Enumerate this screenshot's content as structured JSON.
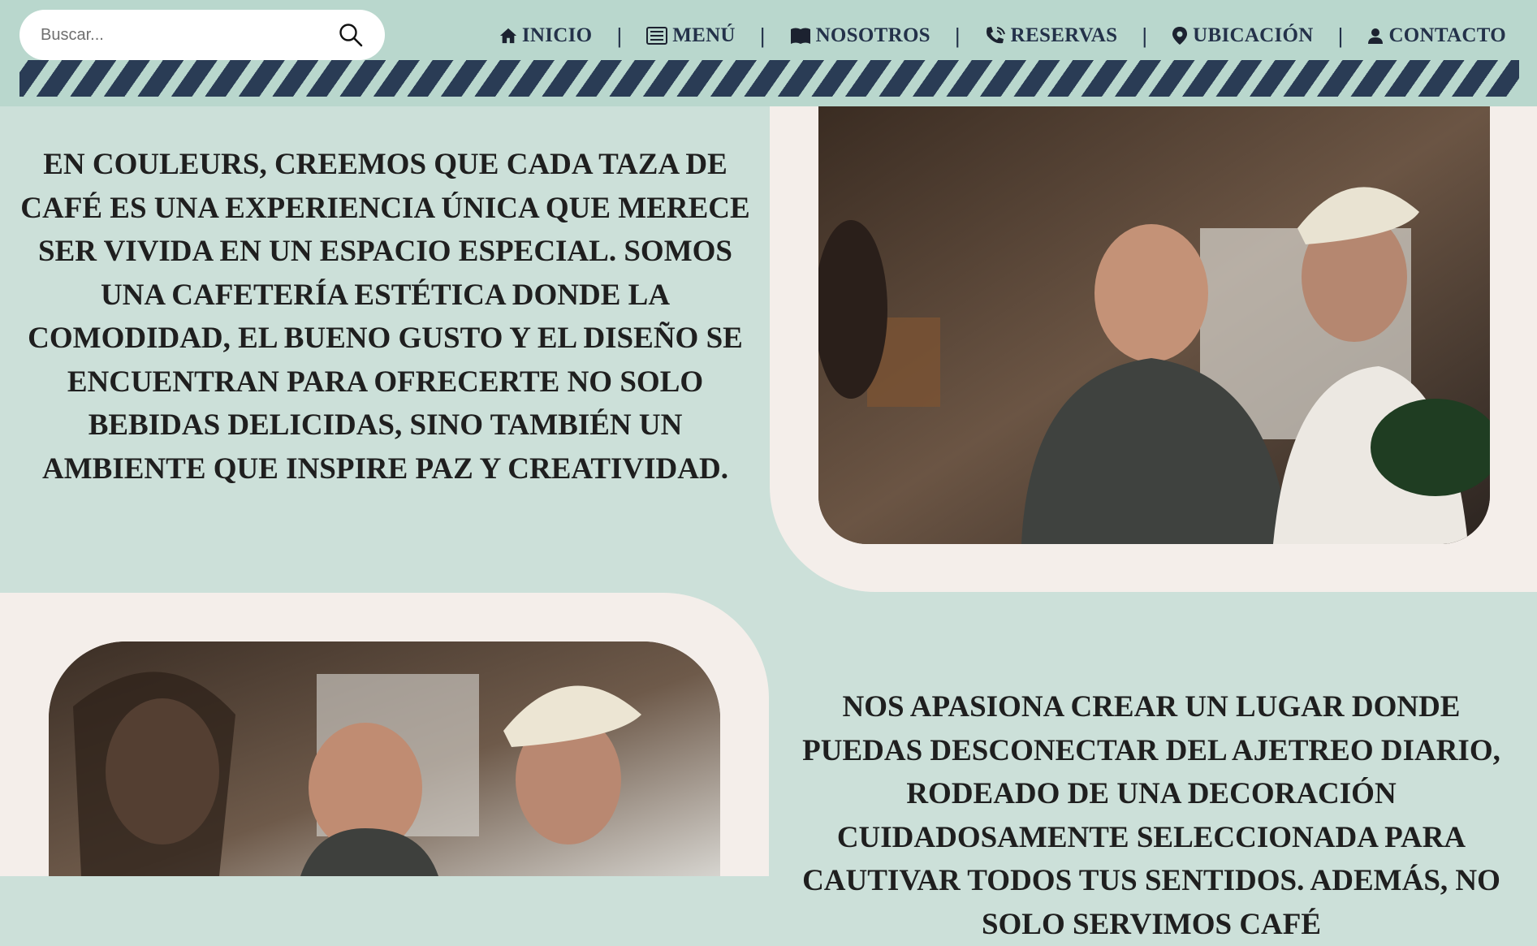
{
  "search": {
    "placeholder": "Buscar..."
  },
  "nav": {
    "items": [
      {
        "label": "INICIO",
        "icon": "home-icon"
      },
      {
        "label": "MENÚ",
        "icon": "menu-list-icon"
      },
      {
        "label": "NOSOTROS",
        "icon": "book-icon"
      },
      {
        "label": "RESERVAS",
        "icon": "phone-icon"
      },
      {
        "label": "UBICACIÓN",
        "icon": "location-pin-icon"
      },
      {
        "label": "CONTACTO",
        "icon": "user-icon"
      }
    ],
    "separator": "|"
  },
  "sections": [
    {
      "text": "En Couleurs, creemos que cada taza de café es una experiencia única que merece ser vivida en un espacio especial. Somos una cafetería estética donde la comodidad, el bueno gusto y el diseño se encuentran para ofrecerte no solo bebidas delicidas, sino también un ambiente que inspire paz y creatividad."
    },
    {
      "text": "Nos apasiona crear un lugar donde puedas desconectar del ajetreo diario, rodeado de una decoración cuidadosamente seleccionada para cautivar todos tus sentidos. Además, no solo servimos café"
    }
  ],
  "colors": {
    "header_bg": "#b9d7cd",
    "page_bg": "#cce0d9",
    "frame_bg": "#f4eeea",
    "accent_navy": "#24324a",
    "text": "#1f1f1f"
  }
}
